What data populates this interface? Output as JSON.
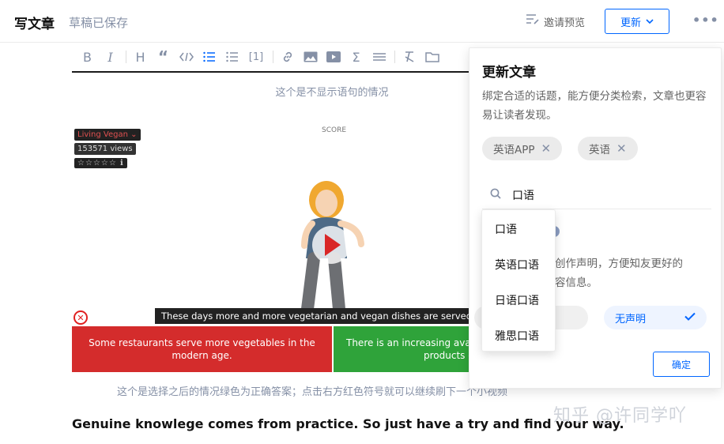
{
  "header": {
    "title": "写文章",
    "draft_status": "草稿已保存",
    "preview_label": "邀请预览",
    "update_label": "更新",
    "more": "•••"
  },
  "toolbar": {
    "items": [
      "bold-icon",
      "italic-icon",
      "heading-icon",
      "quote-icon",
      "code-icon",
      "ordered-list-icon",
      "unordered-list-icon",
      "reference-icon",
      "link-icon",
      "image-icon",
      "video-icon",
      "formula-icon",
      "divider-icon",
      "clear-format-icon",
      "attachment-icon"
    ],
    "reference_label": "[1]"
  },
  "article": {
    "caption_top": "这个是不显示语句的情况",
    "caption_bottom": "这个是选择之后的情况绿色为正确答案；点击右方红色符号就可以继续刷下一个小视频",
    "bold_line": "Genuine knowlege comes from practice. So just have a try and find your way."
  },
  "video": {
    "score_label": "SCORE",
    "channel": "Living Vegan ⌄",
    "views": "153571 views",
    "stars": "☆☆☆☆☆ ℹ",
    "subtitle": "These days more and more vegetarian and vegan dishes are served in res",
    "answer_red": "Some restaurants serve more vegetables in the modern age.",
    "answer_green_1": "There is an increasing availab",
    "answer_green_2": "products or",
    "close_symbol": "✕"
  },
  "panel": {
    "title": "更新文章",
    "description": "绑定合适的话题，能方便分类检索，文章也更容易让读者发现。",
    "chips": [
      {
        "label": "英语APP"
      },
      {
        "label": "英语"
      }
    ],
    "search_value": "口语",
    "partial_desc_1": "创作声明，方便知友更好的",
    "partial_desc_2": "容信息。",
    "no_statement": "无声明",
    "confirm_label": "确定"
  },
  "dropdown": {
    "options": [
      "口语",
      "英语口语",
      "日语口语",
      "雅思口语"
    ]
  },
  "watermark": "知乎 @许同学吖",
  "colors": {
    "accent": "#0066ff",
    "muted": "#8590a6",
    "answer_wrong": "#d42c2c",
    "answer_right": "#2fa33a"
  }
}
